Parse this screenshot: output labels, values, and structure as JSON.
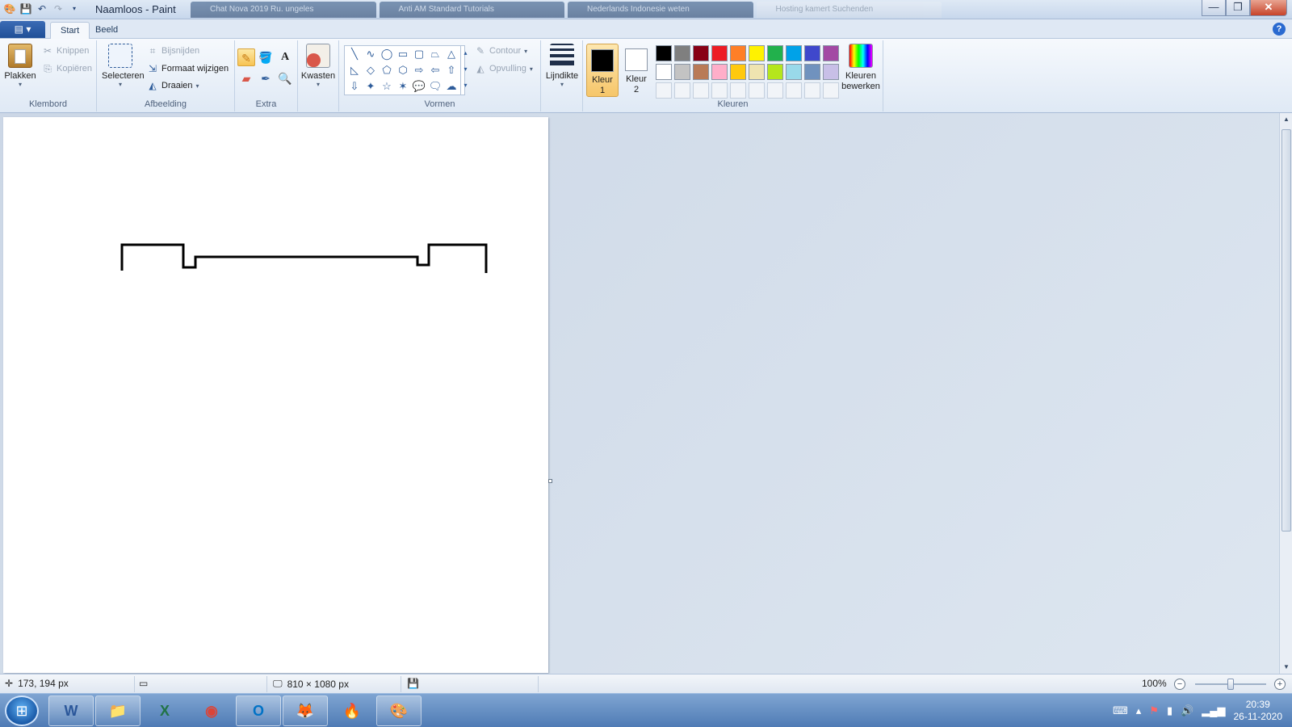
{
  "window": {
    "title": "Naamloos - Paint",
    "background_tabs": [
      "Chat Nova 2019 Ru. ungeles",
      "Anti AM Standard Tutorials",
      "Nederlands Indonesie weten",
      "Hosting kamert Suchenden"
    ],
    "controls": {
      "minimize": "—",
      "maximize": "❐",
      "close": "✕"
    }
  },
  "ribbon": {
    "file_menu": "▤ ▾",
    "tabs": [
      "Start",
      "Beeld"
    ],
    "help": "?",
    "groups": {
      "klembord": {
        "label": "Klembord",
        "paste": "Plakken",
        "cut": "Knippen",
        "copy": "Kopiëren"
      },
      "afbeelding": {
        "label": "Afbeelding",
        "select": "Selecteren",
        "crop": "Bijsnijden",
        "resize": "Formaat wijzigen",
        "rotate": "Draaien"
      },
      "extra": {
        "label": "Extra",
        "brushes": "Kwasten"
      },
      "vormen": {
        "label": "Vormen",
        "outline": "Contour",
        "fill": "Opvulling"
      },
      "lijndikte": "Lijndikte",
      "kleuren": {
        "label": "Kleuren",
        "color1": "Kleur 1",
        "color2": "Kleur 2",
        "edit": "Kleuren bewerken",
        "color1_value": "#000000",
        "color2_value": "#ffffff",
        "palette_row1": [
          "#000000",
          "#7f7f7f",
          "#880015",
          "#ed1c24",
          "#ff7f27",
          "#fff200",
          "#22b14c",
          "#00a2e8",
          "#3f48cc",
          "#a349a4"
        ],
        "palette_row2": [
          "#ffffff",
          "#c3c3c3",
          "#b97a57",
          "#ffaec9",
          "#ffc90e",
          "#efe4b0",
          "#b5e61d",
          "#99d9ea",
          "#7092be",
          "#c8bfe7"
        ]
      }
    }
  },
  "icons": {
    "pencil": "pencil-icon",
    "fill": "fill-bucket-icon",
    "text": "text-icon",
    "eraser": "eraser-icon",
    "picker": "color-picker-icon",
    "magnifier": "magnifier-icon"
  },
  "shapes": [
    "╲",
    "∿",
    "◯",
    "▭",
    "▢",
    "⏢",
    "△",
    "◺",
    "◇",
    "⬠",
    "⬡",
    "⇨",
    "⇦",
    "⇧",
    "⇩",
    "✦",
    "☆",
    "✶",
    "💬",
    "🗨",
    "☁"
  ],
  "status": {
    "cursor_pos": "173, 194 px",
    "canvas_size": "810 × 1080 px",
    "zoom": "100%"
  },
  "taskbar": {
    "apps": [
      "W",
      "📁",
      "X",
      "◉",
      "O",
      "🦊",
      "🔥",
      "🎨"
    ],
    "time": "20:39",
    "date": "26-11-2020"
  }
}
